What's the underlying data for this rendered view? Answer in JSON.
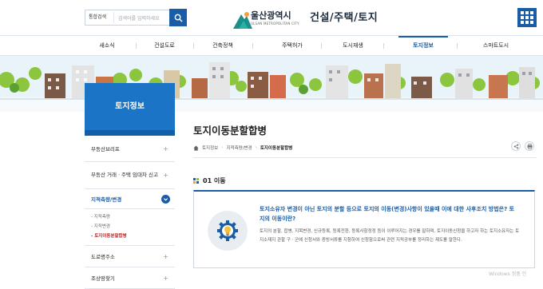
{
  "header": {
    "search_select": "통합검색",
    "search_placeholder": "검색어를 입력하세요",
    "logo_name": "울산광역시",
    "logo_sub": "ULSAN METROPOLITAN CITY",
    "site_title": "건설/주택/토지"
  },
  "gnb": [
    {
      "label": "새소식"
    },
    {
      "label": "건설도로"
    },
    {
      "label": "건축정책"
    },
    {
      "label": "주택허가"
    },
    {
      "label": "도시재생"
    },
    {
      "label": "토지정보"
    },
    {
      "label": "스마트도시"
    }
  ],
  "lnb": {
    "title": "토지정보",
    "items": [
      {
        "label": "부동산브리프"
      },
      {
        "label": "부동산 거래ㆍ주택 임대차 신고"
      },
      {
        "label": "지적측량/변경"
      },
      {
        "label": "도로명주소"
      },
      {
        "label": "조상땅찾기"
      }
    ],
    "sub": [
      {
        "label": "- 지적측량"
      },
      {
        "label": "- 지적변경"
      },
      {
        "label": "- 토지이동분할합병"
      }
    ]
  },
  "content": {
    "page_title": "토지이동분할합병",
    "breadcrumb": [
      "토지정보",
      "지적측량/변경",
      "토지이동분할합병"
    ],
    "section_title": "01 이동",
    "box_title": "토지소유자 변경이 아닌 토지의 분할 등으로 토지의 이동(변경)사항이 있을때 이에 대한 사후조치 방법은? 토지의 이동이란?",
    "box_desc": "토지의 분할, 합병, 지목변경, 신규등록, 등록전환, 등록사항정정 등이 이루어지는 경우를 말하며, 토지이동신청을 하고자 하는 토지소유자는 토지소재지 관할 구ㆍ군에 신청서와 증빙서류를 지참하여 신청함으로써 관련 지적공부를 정리하는 제도를 말한다."
  },
  "watermark": "Windows 정품 인",
  "colors": {
    "primary": "#1a5da6",
    "lnb_title": "#1b74c6",
    "current": "#c12424"
  }
}
